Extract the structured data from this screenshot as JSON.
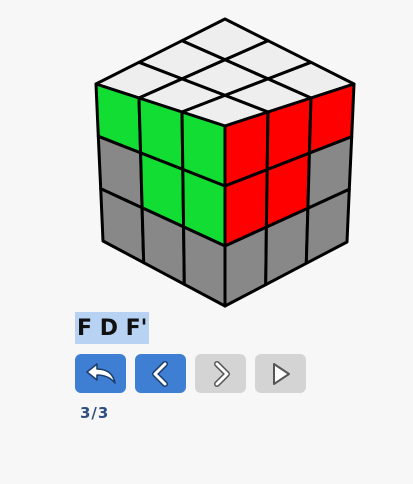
{
  "player": {
    "algorithm": "F D F'",
    "counter": "3/3"
  },
  "cube": {
    "top": [
      [
        "#eeeeee",
        "#eeeeee",
        "#eeeeee"
      ],
      [
        "#eeeeee",
        "#eeeeee",
        "#eeeeee"
      ],
      [
        "#eeeeee",
        "#eeeeee",
        "#eeeeee"
      ]
    ],
    "left": [
      [
        "#11dd33",
        "#11dd33",
        "#11dd33"
      ],
      [
        "#888888",
        "#11dd33",
        "#11dd33"
      ],
      [
        "#888888",
        "#888888",
        "#888888"
      ]
    ],
    "right": [
      [
        "#ff0000",
        "#ff0000",
        "#ff0000"
      ],
      [
        "#ff0000",
        "#ff0000",
        "#888888"
      ],
      [
        "#888888",
        "#888888",
        "#888888"
      ]
    ]
  },
  "controls": [
    {
      "name": "reset-button",
      "icon": "undo-arrow-icon",
      "state": "active"
    },
    {
      "name": "previous-button",
      "icon": "chevron-left-icon",
      "state": "active"
    },
    {
      "name": "next-button",
      "icon": "chevron-right-icon",
      "state": "disabled"
    },
    {
      "name": "play-button",
      "icon": "play-icon",
      "state": "disabled"
    }
  ],
  "colors": {
    "active_button": "#3e7fd4",
    "disabled_button": "#d4d4d4",
    "algorithm_highlight": "#b7d2f3",
    "counter_text": "#2f4f7f"
  }
}
